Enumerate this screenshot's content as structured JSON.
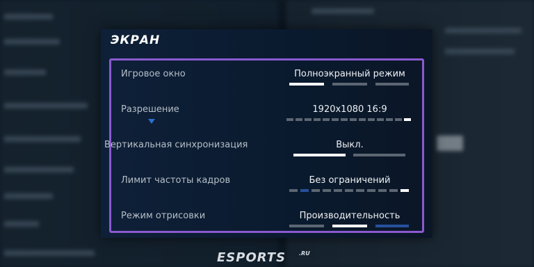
{
  "section_title": "ЭКРАН",
  "settings": [
    {
      "label": "Игровое окно",
      "value": "Полноэкранный режим"
    },
    {
      "label": "Разрешение",
      "value": "1920x1080 16:9"
    },
    {
      "label": "Вертикальная синхронизация",
      "value": "Выкл."
    },
    {
      "label": "Лимит частоты кадров",
      "value": "Без ограничений"
    },
    {
      "label": "Режим отрисовки",
      "value": "Производительность"
    }
  ],
  "watermark": {
    "main": "ESPORTS",
    "suffix": ".RU"
  },
  "colors": {
    "frame": "#8a5ad0",
    "panel_bg": "#0e2038",
    "selected": "#ffffff",
    "inactive": "#5c6672",
    "accent_blue": "#27509c"
  }
}
